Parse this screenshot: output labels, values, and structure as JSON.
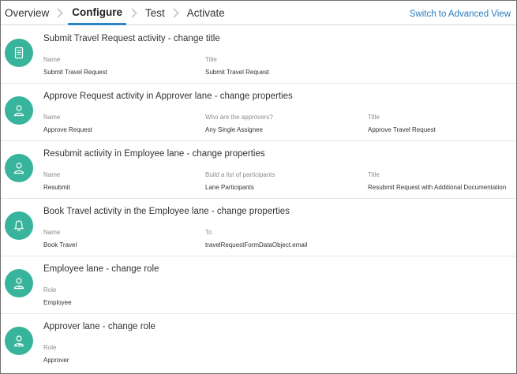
{
  "header": {
    "tabs": [
      {
        "label": "Overview"
      },
      {
        "label": "Configure"
      },
      {
        "label": "Test"
      },
      {
        "label": "Activate"
      }
    ],
    "active_tab": "Configure",
    "advanced_link": "Switch to Advanced View"
  },
  "colors": {
    "accent": "#2b86c9",
    "avatar": "#37b49b",
    "link": "#2b7bbd"
  },
  "changes": [
    {
      "title": "Submit Travel Request activity - change title",
      "icon": "form-icon",
      "fields": [
        {
          "label": "Name",
          "value": "Submit Travel Request"
        },
        {
          "label": "Title",
          "value": "Submit Travel Request"
        }
      ]
    },
    {
      "title": "Approve Request activity in Approver lane - change properties",
      "icon": "person-icon",
      "fields": [
        {
          "label": "Name",
          "value": "Approve Request"
        },
        {
          "label": "Who are the approvers?",
          "value": "Any Single Assignee"
        },
        {
          "label": "Title",
          "value": "Approve Travel Request"
        }
      ]
    },
    {
      "title": "Resubmit activity in Employee lane - change properties",
      "icon": "person-icon",
      "fields": [
        {
          "label": "Name",
          "value": "Resubmit"
        },
        {
          "label": "Build a list of participants",
          "value": "Lane Participants"
        },
        {
          "label": "Title",
          "value": "Resubmit Request with Additional Documentation"
        }
      ]
    },
    {
      "title": "Book Travel activity in the Employee lane - change properties",
      "icon": "bell-icon",
      "fields": [
        {
          "label": "Name",
          "value": "Book Travel"
        },
        {
          "label": "To",
          "value": "travelRequestFormDataObject.email"
        }
      ]
    },
    {
      "title": "Employee lane - change role",
      "icon": "role-person-icon",
      "fields": [
        {
          "label": "Role",
          "value": "Employee"
        }
      ]
    },
    {
      "title": "Approver lane - change role",
      "icon": "role-person-icon",
      "fields": [
        {
          "label": "Role",
          "value": "Approver"
        }
      ]
    }
  ]
}
